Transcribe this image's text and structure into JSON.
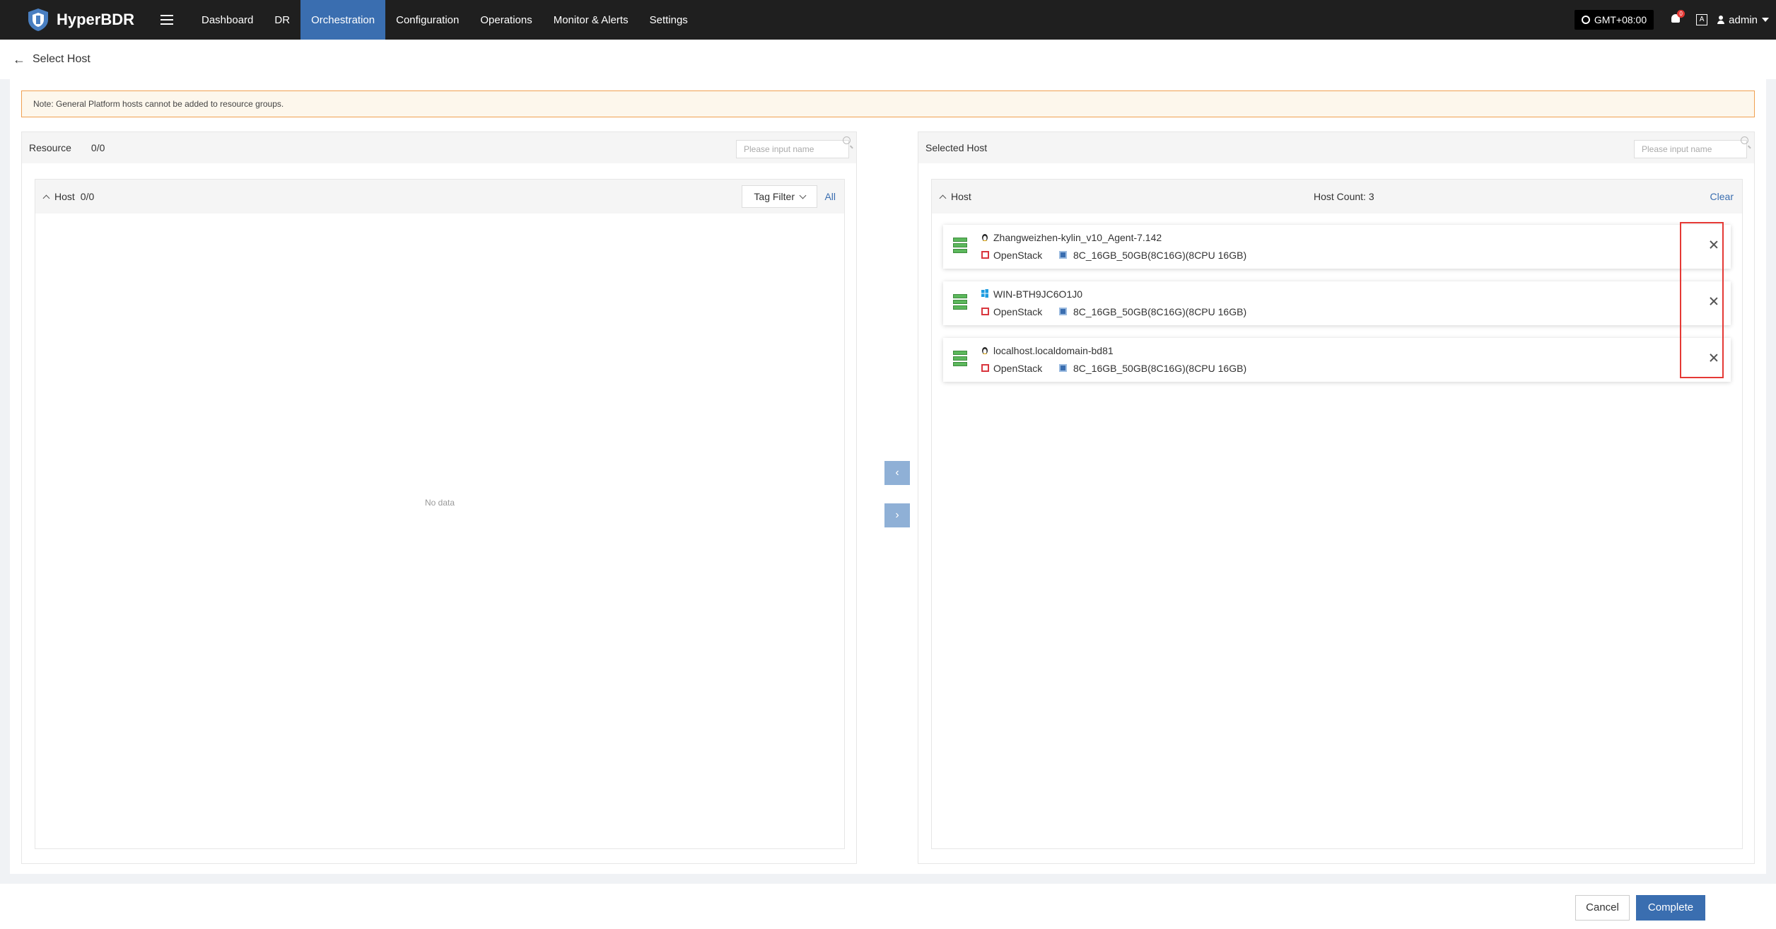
{
  "app": {
    "name": "HyperBDR"
  },
  "nav": {
    "items": [
      "Dashboard",
      "DR",
      "Orchestration",
      "Configuration",
      "Operations",
      "Monitor & Alerts",
      "Settings"
    ],
    "active": "Orchestration"
  },
  "topright": {
    "timezone": "GMT+08:00",
    "notification_count": "0",
    "lang_label": "A",
    "user": "admin"
  },
  "page": {
    "title": "Select Host"
  },
  "note": "Note: General Platform hosts cannot be added to resource groups.",
  "left_panel": {
    "title": "Resource",
    "count": "0/0",
    "search_placeholder": "Please input name",
    "host_group": {
      "label": "Host",
      "count": "0/0"
    },
    "tag_filter": "Tag Filter",
    "all_link": "All",
    "empty_text": "No data"
  },
  "right_panel": {
    "title": "Selected Host",
    "search_placeholder": "Please input name",
    "host_group": {
      "label": "Host",
      "host_count": "Host Count: 3"
    },
    "clear_link": "Clear",
    "hosts": [
      {
        "name": "Zhangweizhen-kylin_v10_Agent-7.142",
        "os": "linux",
        "platform": "OpenStack",
        "spec": "8C_16GB_50GB(8C16G)(8CPU 16GB)"
      },
      {
        "name": "WIN-BTH9JC6O1J0",
        "os": "windows",
        "platform": "OpenStack",
        "spec": "8C_16GB_50GB(8C16G)(8CPU 16GB)"
      },
      {
        "name": "localhost.localdomain-bd81",
        "os": "linux",
        "platform": "OpenStack",
        "spec": "8C_16GB_50GB(8C16G)(8CPU 16GB)"
      }
    ]
  },
  "transfer": {
    "left_glyph": "‹",
    "right_glyph": "›"
  },
  "footer": {
    "cancel": "Cancel",
    "complete": "Complete"
  },
  "colors": {
    "accent": "#3a6eb0",
    "topbar": "#1f1f1f",
    "highlight": "#e53935"
  }
}
